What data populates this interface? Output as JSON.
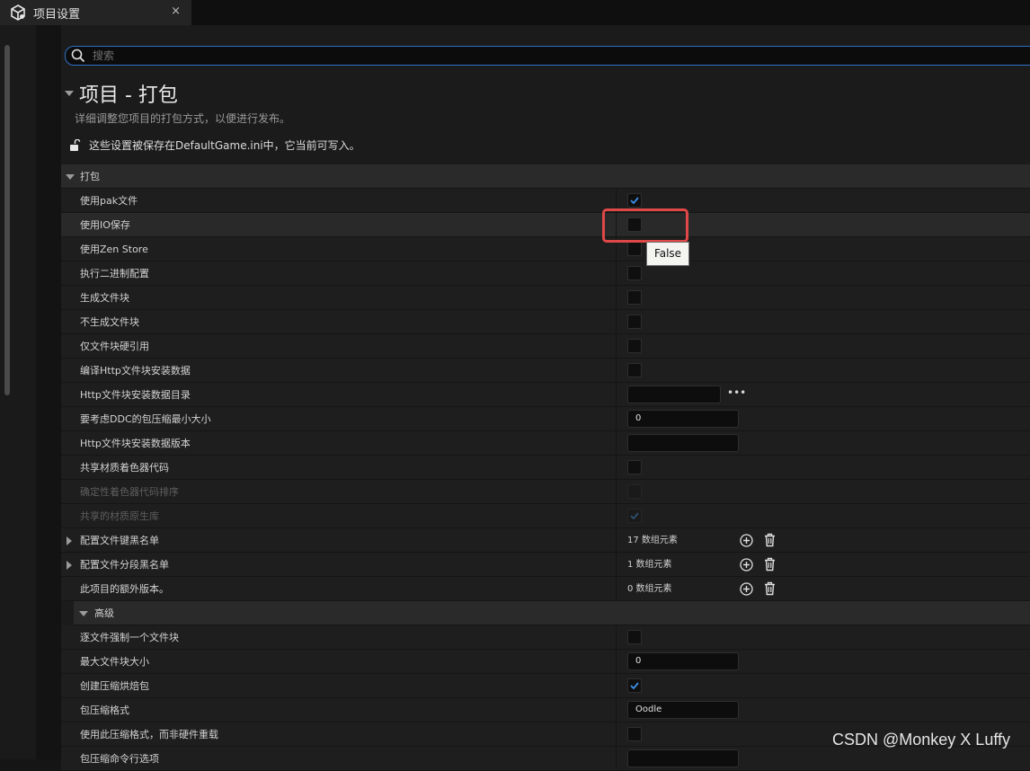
{
  "tab": {
    "title": "项目设置",
    "close": "×"
  },
  "search": {
    "placeholder": "搜索"
  },
  "section": {
    "title": "项目 - 打包",
    "description": "详细调整您项目的打包方式，以便进行发布。",
    "saved_notice": "这些设置被保存在DefaultGame.ini中，它当前可写入。"
  },
  "category": {
    "label": "打包"
  },
  "rows": [
    {
      "label": "使用pak文件",
      "control": "checkbox",
      "checked": true
    },
    {
      "label": "使用IO保存",
      "control": "checkbox",
      "checked": false
    },
    {
      "label": "使用Zen Store",
      "control": "checkbox",
      "checked": false
    },
    {
      "label": "执行二进制配置",
      "control": "checkbox",
      "checked": false
    },
    {
      "label": "生成文件块",
      "control": "checkbox",
      "checked": false
    },
    {
      "label": "不生成文件块",
      "control": "checkbox",
      "checked": false
    },
    {
      "label": "仅文件块硬引用",
      "control": "checkbox",
      "checked": false
    },
    {
      "label": "编译Http文件块安装数据",
      "control": "checkbox",
      "checked": false
    },
    {
      "label": "Http文件块安装数据目录",
      "control": "path",
      "value": ""
    },
    {
      "label": "要考虑DDC的包压缩最小大小",
      "control": "text",
      "value": "0"
    },
    {
      "label": "Http文件块安装数据版本",
      "control": "text",
      "value": ""
    },
    {
      "label": "共享材质着色器代码",
      "control": "checkbox",
      "checked": false
    },
    {
      "label": "确定性着色器代码排序",
      "control": "checkbox",
      "checked": false,
      "disabled": true
    },
    {
      "label": "共享的材质原生库",
      "control": "checkbox",
      "checked": true,
      "disabled": true
    },
    {
      "label": "配置文件键黑名单",
      "control": "array",
      "value": "17 数组元素",
      "expandable": true
    },
    {
      "label": "配置文件分段黑名单",
      "control": "array",
      "value": "1 数组元素",
      "expandable": true
    },
    {
      "label": "此项目的额外版本。",
      "control": "array",
      "value": "0 数组元素"
    }
  ],
  "subcategory": {
    "label": "高级"
  },
  "adv_rows": [
    {
      "label": "逐文件强制一个文件块",
      "control": "checkbox",
      "checked": false
    },
    {
      "label": "最大文件块大小",
      "control": "text",
      "value": "0"
    },
    {
      "label": "创建压缩烘焙包",
      "control": "checkbox",
      "checked": true
    },
    {
      "label": "包压缩格式",
      "control": "text",
      "value": "Oodle"
    },
    {
      "label": "使用此压缩格式，而非硬件重载",
      "control": "checkbox",
      "checked": false
    },
    {
      "label": "包压缩命令行选项",
      "control": "text",
      "value": ""
    }
  ],
  "tooltip": {
    "text": "False"
  },
  "watermark": "CSDN @Monkey X Luffy",
  "colors": {
    "accent": "#2f71c6",
    "highlight_box": "#e04848",
    "check": "#3d8ee8"
  }
}
